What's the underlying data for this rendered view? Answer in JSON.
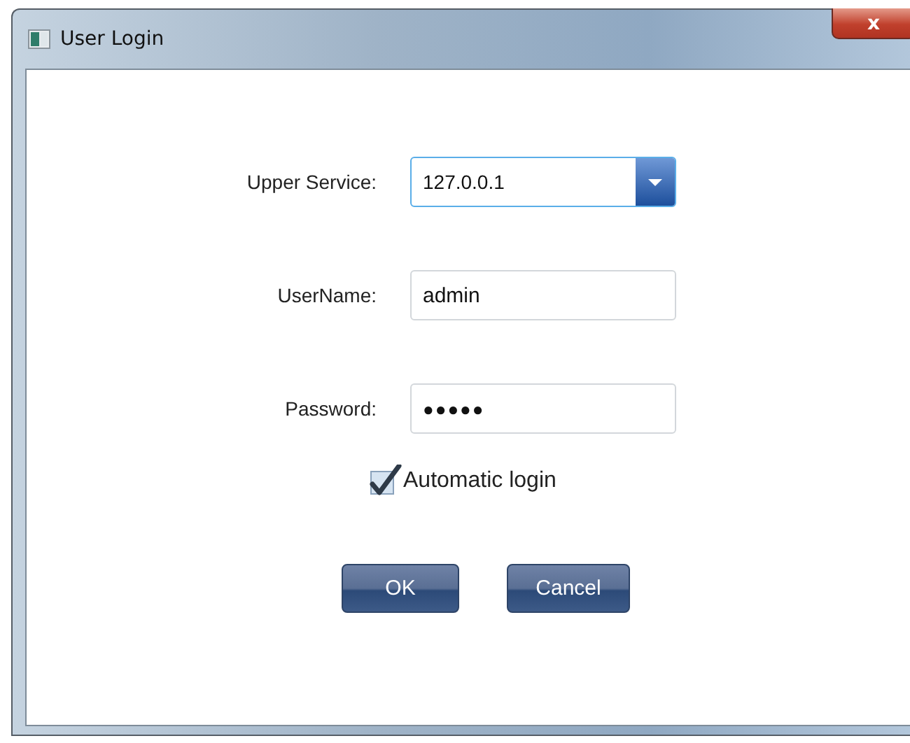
{
  "window": {
    "title": "User Login",
    "close": "x"
  },
  "fields": [
    {
      "label": "Upper Service:",
      "value": "127.0.0.1",
      "kind": "dropdown"
    },
    {
      "label": "UserName:",
      "value": "admin",
      "kind": "text"
    },
    {
      "label": "Password:",
      "value": "●●●●●",
      "kind": "password"
    }
  ],
  "auto_login": {
    "label": "Automatic login",
    "checked": true
  },
  "buttons": [
    "OK",
    "Cancel"
  ]
}
